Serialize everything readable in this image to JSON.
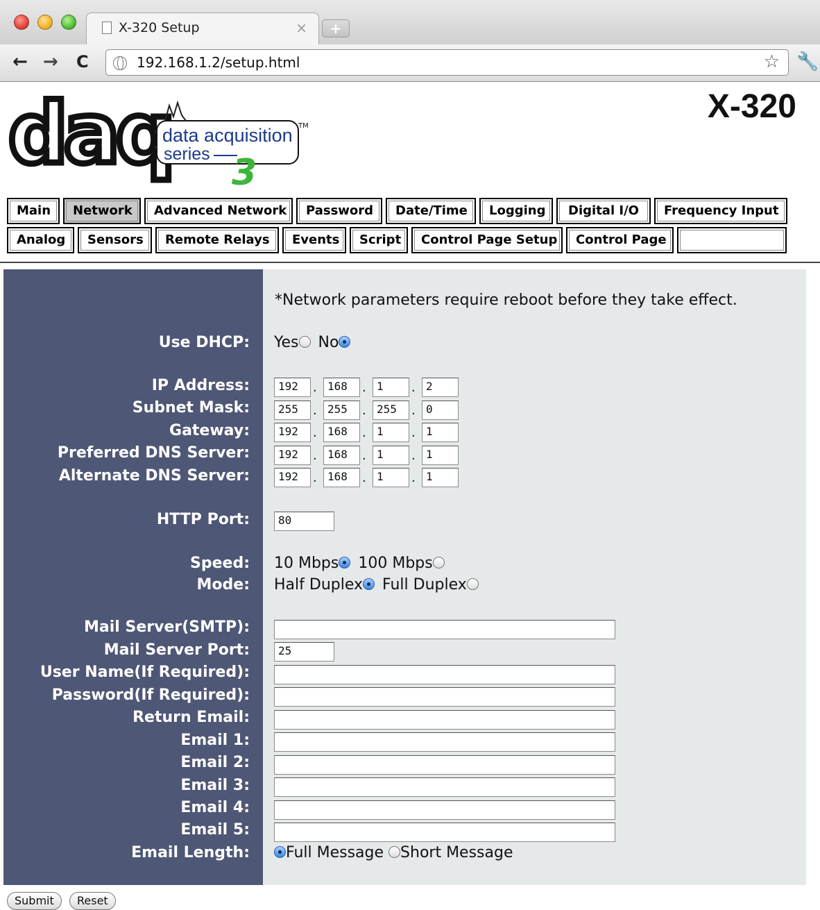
{
  "browser": {
    "tab_title": "X-320 Setup",
    "tab_close": "×",
    "new_tab": "+",
    "url": "192.168.1.2/setup.html",
    "icons": [
      "back-icon",
      "forward-icon",
      "reload-icon",
      "globe-icon",
      "star-icon",
      "wrench-icon"
    ]
  },
  "header": {
    "logo_daq": "daq",
    "logo_line1": "data acquisition",
    "logo_line2": "series",
    "logo_tm": "TM",
    "logo_num": "3",
    "model": "X-320"
  },
  "tabs": {
    "row1": [
      "Main",
      "Network",
      "Advanced Network",
      "Password",
      "Date/Time",
      "Logging",
      "Digital I/O",
      "Frequency Input"
    ],
    "row2": [
      "Analog",
      "Sensors",
      "Remote Relays",
      "Events",
      "Script",
      "Control Page Setup",
      "Control Page",
      ""
    ],
    "active": "Network"
  },
  "form": {
    "note": "*Network parameters require reboot before they take effect.",
    "dhcp_label": "Use DHCP:",
    "dhcp_yes": "Yes",
    "dhcp_no": "No",
    "dhcp_value": "No",
    "ip_label": "IP Address:",
    "ip": [
      "192",
      "168",
      "1",
      "2"
    ],
    "subnet_label": "Subnet Mask:",
    "subnet": [
      "255",
      "255",
      "255",
      "0"
    ],
    "gateway_label": "Gateway:",
    "gateway": [
      "192",
      "168",
      "1",
      "1"
    ],
    "pdns_label": "Preferred DNS Server:",
    "pdns": [
      "192",
      "168",
      "1",
      "1"
    ],
    "adns_label": "Alternate DNS Server:",
    "adns": [
      "192",
      "168",
      "1",
      "1"
    ],
    "http_label": "HTTP Port:",
    "http_port": "80",
    "speed_label": "Speed:",
    "speed_10": "10 Mbps",
    "speed_100": "100 Mbps",
    "speed_value": "10 Mbps",
    "mode_label": "Mode:",
    "mode_half": "Half Duplex",
    "mode_full": "Full Duplex",
    "mode_value": "Half Duplex",
    "smtp_label": "Mail Server(SMTP):",
    "smtp": "",
    "mailport_label": "Mail Server Port:",
    "mailport": "25",
    "user_label": "User Name(If Required):",
    "user": "",
    "pass_label": "Password(If Required):",
    "pass": "",
    "return_label": "Return Email:",
    "return_email": "",
    "email1_label": "Email 1:",
    "email2_label": "Email 2:",
    "email3_label": "Email 3:",
    "email4_label": "Email 4:",
    "email5_label": "Email 5:",
    "emails": [
      "",
      "",
      "",
      "",
      ""
    ],
    "length_label": "Email Length:",
    "length_full": "Full Message",
    "length_short": "Short Message",
    "length_value": "Full Message"
  },
  "buttons": {
    "submit": "Submit",
    "reset": "Reset"
  }
}
